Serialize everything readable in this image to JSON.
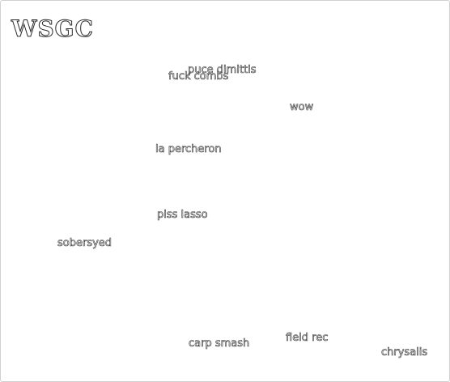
{
  "logo": {
    "text": "WSGC"
  },
  "words": [
    {
      "text": "puce dimittis"
    },
    {
      "text": "fuck combs"
    },
    {
      "text": "wow"
    },
    {
      "text": "la percheron"
    },
    {
      "text": "piss lasso"
    },
    {
      "text": "sobersyed"
    },
    {
      "text": "field rec"
    },
    {
      "text": "carp smash"
    },
    {
      "text": "chrysalis"
    }
  ],
  "colors": {
    "background": "#ffffff",
    "outline": "#333333"
  }
}
